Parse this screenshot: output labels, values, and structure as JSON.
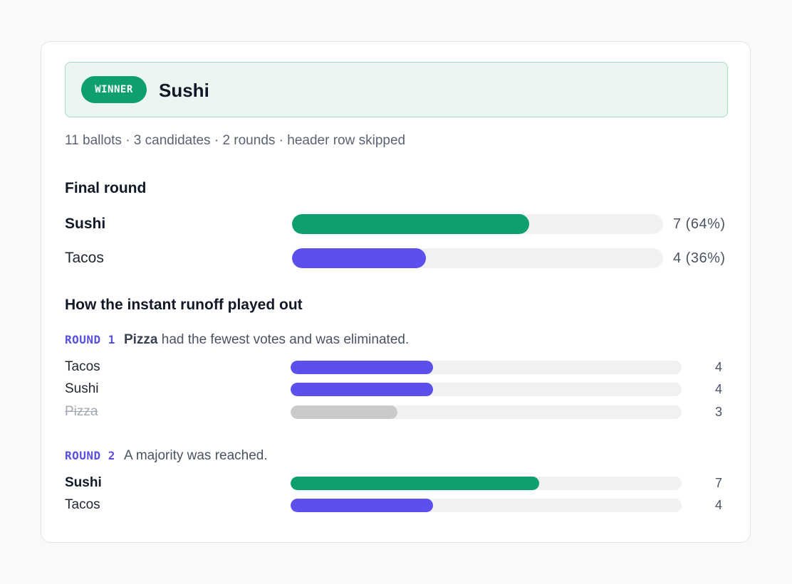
{
  "winner": {
    "badge": "WINNER",
    "name": "Sushi"
  },
  "summary": "11 ballots · 3 candidates · 2 rounds · header row skipped",
  "final_round": {
    "title": "Final round",
    "rows": [
      {
        "name": "Sushi",
        "value_label": "7 (64%)",
        "votes": 7,
        "share": 0.64,
        "status": "winner"
      },
      {
        "name": "Tacos",
        "value_label": "4 (36%)",
        "votes": 4,
        "share": 0.36,
        "status": "normal"
      }
    ]
  },
  "runoff": {
    "title": "How the instant runoff played out",
    "rounds": [
      {
        "tag": "ROUND 1",
        "eliminated": "Pizza",
        "message": "had the fewest votes and was eliminated.",
        "rows": [
          {
            "name": "Tacos",
            "votes": 4,
            "value_label": "4",
            "status": "normal"
          },
          {
            "name": "Sushi",
            "votes": 4,
            "value_label": "4",
            "status": "normal"
          },
          {
            "name": "Pizza",
            "votes": 3,
            "value_label": "3",
            "status": "eliminated"
          }
        ]
      },
      {
        "tag": "ROUND 2",
        "message": "A majority was reached.",
        "rows": [
          {
            "name": "Sushi",
            "votes": 7,
            "value_label": "7",
            "status": "winner"
          },
          {
            "name": "Tacos",
            "votes": 4,
            "value_label": "4",
            "status": "normal"
          }
        ]
      }
    ]
  },
  "total_ballots": 11,
  "colors": {
    "winner": "#0e9f6e",
    "normal": "#5b50ec",
    "eliminated": "#cacacd",
    "track": "#f1f1f1",
    "round_tag": "#5b4fe0"
  }
}
